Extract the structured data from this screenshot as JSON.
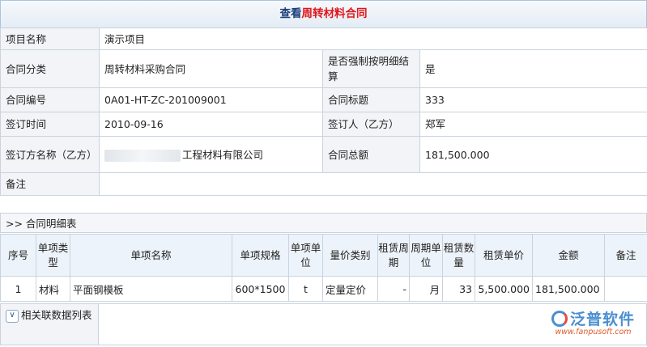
{
  "page": {
    "title_prefix": "查看",
    "title_highlight": "周转材料合同"
  },
  "info": {
    "project_label": "项目名称",
    "project_value": "演示项目",
    "category_label": "合同分类",
    "category_value": "周转材料采购合同",
    "forced_label": "是否强制按明细结算",
    "forced_value": "是",
    "number_label": "合同编号",
    "number_value": "0A01-HT-ZC-201009001",
    "subject_label": "合同标题",
    "subject_value": "333",
    "date_label": "签订时间",
    "date_value": "2010-09-16",
    "signer_label": "签订人（乙方）",
    "signer_value": "郑军",
    "party_label": "签订方名称（乙方）",
    "party_value": "工程材料有限公司",
    "total_label": "合同总额",
    "total_value": "181,500.000",
    "remark_label": "备注",
    "remark_value": ""
  },
  "detail": {
    "section_title": ">> 合同明细表",
    "columns": [
      "序号",
      "单项类型",
      "单项名称",
      "单项规格",
      "单项单位",
      "量价类别",
      "租赁周期",
      "周期单位",
      "租赁数量",
      "租赁单价",
      "金额",
      "备注"
    ],
    "rows": [
      {
        "no": "1",
        "type": "材料",
        "name": "平面钢模板",
        "spec": "600*1500",
        "unit": "t",
        "price_type": "定量定价",
        "period": "-",
        "period_unit": "月",
        "qty": "33",
        "unit_price": "5,500.000",
        "amount": "181,500.000",
        "remark": ""
      }
    ]
  },
  "related": {
    "label": "相关联数据列表",
    "expand_icon": "chevron-double-down-icon"
  },
  "logo": {
    "text": "泛普软件",
    "url": "www.fanpusoft.com"
  }
}
